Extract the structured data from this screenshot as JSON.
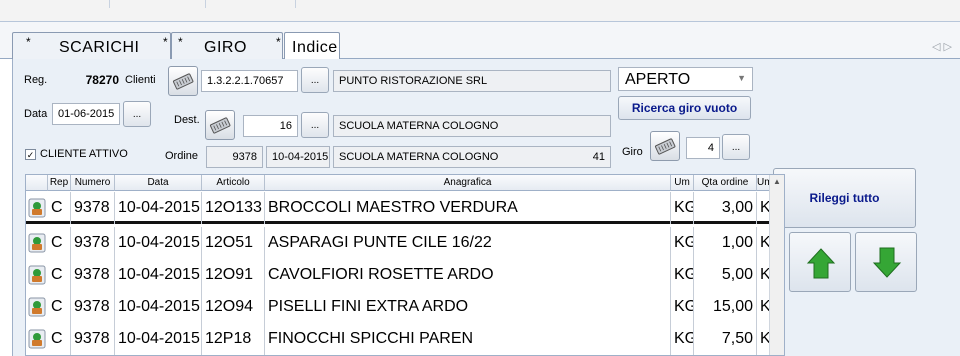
{
  "tabs": [
    {
      "label": "SCARICHI",
      "star_left": "*",
      "star_right": "*"
    },
    {
      "label": "GIRO",
      "star_left": "*",
      "star_right": "*"
    },
    {
      "label": "Indice"
    }
  ],
  "nav_arrows": "◁ ▷",
  "form": {
    "reg_label": "Reg.",
    "reg_value": "78270",
    "clienti_label": "Clienti",
    "clienti_code": "1.3.2.2.1.70657",
    "clienti_name": "PUNTO RISTORAZIONE SRL",
    "data_label": "Data",
    "data_value": "01-06-2015",
    "dest_label": "Dest.",
    "dest_code": "16",
    "dest_name": "SCUOLA MATERNA COLOGNO",
    "cliente_attivo_label": "CLIENTE ATTIVO",
    "cliente_attivo_checked": "✓",
    "ordine_label": "Ordine",
    "ordine_num": "9378",
    "ordine_date": "10-04-2015",
    "ordine_name": "SCUOLA MATERNA COLOGNO",
    "ordine_count": "41",
    "status_value": "APERTO",
    "ricerca_button": "Ricerca giro vuoto",
    "giro_label": "Giro",
    "giro_value": "4",
    "dots": "..."
  },
  "side": {
    "rileggi_button": "Rileggi tutto"
  },
  "grid": {
    "headers": [
      "Rep",
      "Numero",
      "Data",
      "Articolo",
      "Anagrafica",
      "Um",
      "Qta ordine",
      "Um"
    ],
    "rows": [
      {
        "rep": "C",
        "numero": "9378",
        "data": "10-04-2015",
        "articolo": "12O133",
        "anagrafica": "BROCCOLI MAESTRO VERDURA",
        "um": "KG",
        "qta": "3,00",
        "um2": "K("
      },
      {
        "rep": "C",
        "numero": "9378",
        "data": "10-04-2015",
        "articolo": "12O51",
        "anagrafica": "ASPARAGI PUNTE CILE 16/22",
        "um": "KG",
        "qta": "1,00",
        "um2": "K("
      },
      {
        "rep": "C",
        "numero": "9378",
        "data": "10-04-2015",
        "articolo": "12O91",
        "anagrafica": "CAVOLFIORI ROSETTE ARDO",
        "um": "KG",
        "qta": "5,00",
        "um2": "K("
      },
      {
        "rep": "C",
        "numero": "9378",
        "data": "10-04-2015",
        "articolo": "12O94",
        "anagrafica": "PISELLI FINI EXTRA ARDO",
        "um": "KG",
        "qta": "15,00",
        "um2": "K("
      },
      {
        "rep": "C",
        "numero": "9378",
        "data": "10-04-2015",
        "articolo": "12P18",
        "anagrafica": "FINOCCHI SPICCHI PAREN",
        "um": "KG",
        "qta": "7,50",
        "um2": "K("
      }
    ]
  },
  "colors": {
    "accent_green": "#2e9a2e",
    "tab_border": "#8a9ab2",
    "panel_bg": "#eaf0f7",
    "status_blue": "#0a1a8c"
  }
}
